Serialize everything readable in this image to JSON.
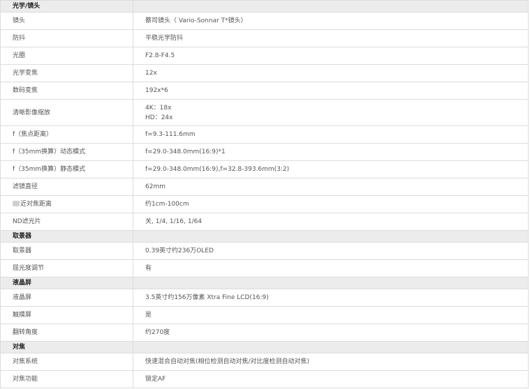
{
  "sections": [
    {
      "title": "光学/镜头",
      "rows": [
        {
          "label": "镜头",
          "values": [
            "蔡司镜头（ Vario-Sonnar T*镜头）"
          ]
        },
        {
          "label": "防抖",
          "values": [
            "平稳光学防抖"
          ]
        },
        {
          "label": "光圈",
          "values": [
            "F2.8-F4.5"
          ]
        },
        {
          "label": "光学变焦",
          "values": [
            "12x"
          ]
        },
        {
          "label": "数码变焦",
          "values": [
            "192x*6"
          ]
        },
        {
          "label": "清晰影像缩放",
          "values": [
            "4K：18x",
            "HD：24x"
          ]
        },
        {
          "label": "f（焦点距离）",
          "values": [
            "f=9.3-111.6mm"
          ]
        },
        {
          "label": "f（35mm换算）动态模式",
          "values": [
            "f=29.0-348.0mm(16:9)*1"
          ]
        },
        {
          "label": "f（35mm换算）静态模式",
          "values": [
            "f=29.0-348.0mm(16:9),f=32.8-393.6mm(3:2)"
          ]
        },
        {
          "label": "滤镜直径",
          "values": [
            "62mm"
          ]
        },
        {
          "label": "近对焦距离",
          "values": [
            "约1cm-100cm"
          ],
          "icon": "blurred-icon"
        },
        {
          "label": "ND滤光片",
          "values": [
            "关, 1/4, 1/16, 1/64"
          ]
        }
      ]
    },
    {
      "title": "取景器",
      "rows": [
        {
          "label": "取景器",
          "values": [
            "0.39英寸约236万OLED"
          ]
        },
        {
          "label": "屈光度调节",
          "values": [
            "有"
          ]
        }
      ]
    },
    {
      "title": "液晶屏",
      "rows": [
        {
          "label": "液晶屏",
          "values": [
            "3.5英寸约156万像素 Xtra Fine LCD(16:9)"
          ]
        },
        {
          "label": "触摸屏",
          "values": [
            "是"
          ]
        },
        {
          "label": "翻转角度",
          "values": [
            "约270度"
          ]
        }
      ]
    },
    {
      "title": "对焦",
      "rows": [
        {
          "label": "对焦系统",
          "values": [
            "快速混合自动对焦(相位检测自动对焦/对比度检测自动对焦)"
          ]
        },
        {
          "label": "对焦功能",
          "values": [
            "锁定AF"
          ]
        }
      ]
    }
  ]
}
